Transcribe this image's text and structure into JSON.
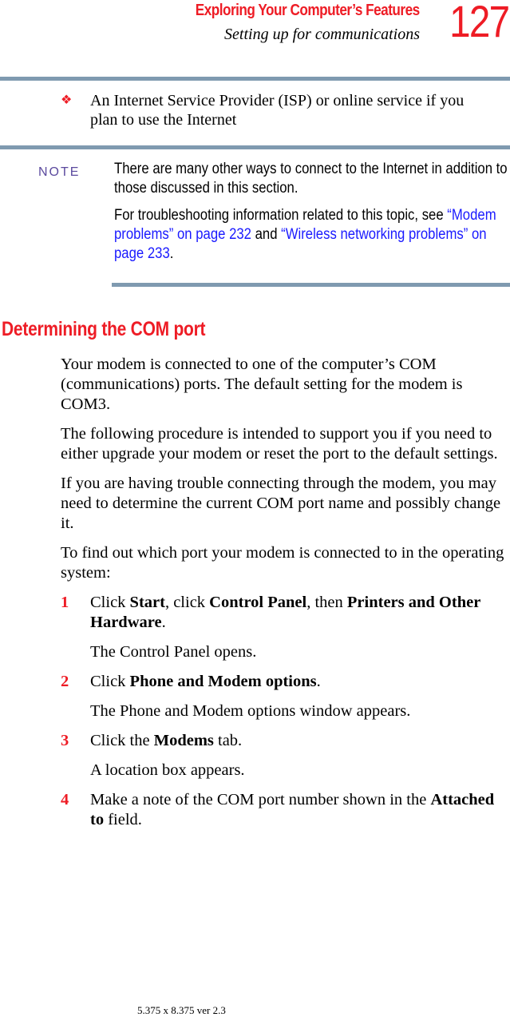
{
  "header": {
    "chapter_title": "Exploring Your Computer’s Features",
    "section_subtitle": "Setting up for communications",
    "page_number": "127"
  },
  "bullet_item": {
    "icon": "diamond-bullet-icon",
    "text": "An Internet Service Provider (ISP) or online service if you plan to use the Internet"
  },
  "note": {
    "label": "NOTE",
    "paragraph1": "There are many other ways to connect to the Internet in addition to those discussed in this section.",
    "paragraph2_prefix": "For troubleshooting information related to this topic, see ",
    "link1": "“Modem problems” on page 232",
    "paragraph2_middle": " and ",
    "link2": "“Wireless networking problems” on page 233",
    "paragraph2_suffix": "."
  },
  "section": {
    "title": "Determining the COM port",
    "paragraphs": [
      "Your modem is connected to one of the computer’s COM (communications) ports. The default setting for the modem is COM3.",
      "The following procedure is intended to support you if you need to either upgrade your modem or reset the port to the default settings.",
      "If you are having trouble connecting through the modem, you may need to determine the current COM port name and possibly change it.",
      "To find out which port your modem is connected to in the operating system:"
    ],
    "steps": [
      {
        "number": "1",
        "parts": [
          {
            "t": "Click ",
            "b": false
          },
          {
            "t": "Start",
            "b": true
          },
          {
            "t": ", click ",
            "b": false
          },
          {
            "t": "Control Panel",
            "b": true
          },
          {
            "t": ", then ",
            "b": false
          },
          {
            "t": "Printers and Other Hardware",
            "b": true
          },
          {
            "t": ".",
            "b": false
          }
        ],
        "result": "The Control Panel opens."
      },
      {
        "number": "2",
        "parts": [
          {
            "t": "Click ",
            "b": false
          },
          {
            "t": "Phone and Modem options",
            "b": true
          },
          {
            "t": ".",
            "b": false
          }
        ],
        "result": "The Phone and Modem options window appears."
      },
      {
        "number": "3",
        "parts": [
          {
            "t": "Click the ",
            "b": false
          },
          {
            "t": "Modems",
            "b": true
          },
          {
            "t": " tab.",
            "b": false
          }
        ],
        "result": "A location box appears."
      },
      {
        "number": "4",
        "parts": [
          {
            "t": "Make a note of the COM port number shown in the ",
            "b": false
          },
          {
            "t": "Attached to",
            "b": true
          },
          {
            "t": " field.",
            "b": false
          }
        ],
        "result": null
      }
    ]
  },
  "footer": {
    "text": "5.375 x 8.375 ver 2.3"
  },
  "colors": {
    "accent_red": "#ee1c25",
    "rule_bar": "#7f9ab0",
    "note_label": "#5b4a9e",
    "link_blue": "#1a1aff"
  }
}
